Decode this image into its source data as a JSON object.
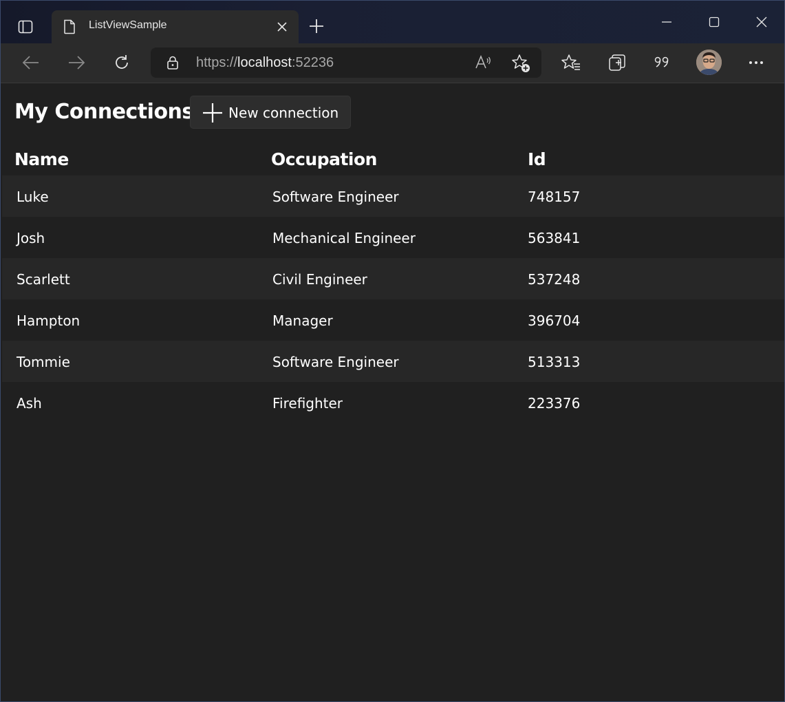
{
  "browser": {
    "tab_title": "ListViewSample",
    "url_scheme": "https://",
    "url_host": "localhost",
    "url_port": ":52236"
  },
  "page": {
    "title": "My Connections",
    "new_connection_label": "New connection",
    "columns": [
      "Name",
      "Occupation",
      "Id"
    ],
    "rows": [
      {
        "name": "Luke",
        "occupation": "Software Engineer",
        "id": "748157"
      },
      {
        "name": "Josh",
        "occupation": "Mechanical Engineer",
        "id": "563841"
      },
      {
        "name": "Scarlett",
        "occupation": "Civil Engineer",
        "id": "537248"
      },
      {
        "name": "Hampton",
        "occupation": "Manager",
        "id": "396704"
      },
      {
        "name": "Tommie",
        "occupation": "Software Engineer",
        "id": "513313"
      },
      {
        "name": "Ash",
        "occupation": "Firefighter",
        "id": "223376"
      }
    ]
  },
  "icons": {
    "tab_actions": "tab-actions-icon",
    "page": "page-icon",
    "close": "close-icon",
    "new_tab": "plus-icon",
    "minimize": "minimize-icon",
    "maximize": "maximize-icon",
    "window_close": "close-icon",
    "back": "back-arrow-icon",
    "forward": "forward-arrow-icon",
    "refresh": "refresh-icon",
    "lock": "lock-icon",
    "read_aloud": "read-aloud-icon",
    "add_favorite": "star-add-icon",
    "favorites": "favorites-icon",
    "collections": "collections-icon",
    "quote": "quote-icon",
    "more": "more-icon"
  }
}
